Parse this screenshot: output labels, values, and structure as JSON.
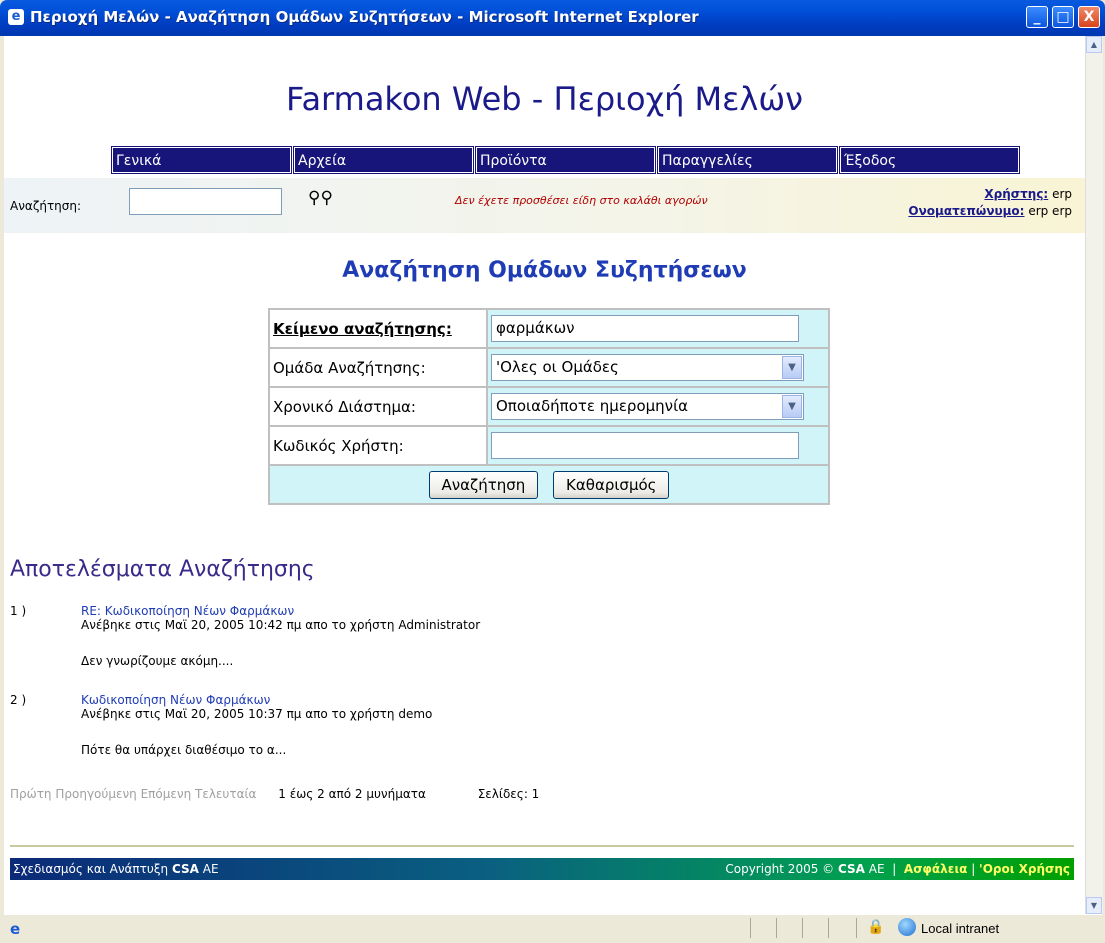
{
  "window": {
    "title": "Περιοχή Μελών - Αναζήτηση Ομάδων Συζητήσεων - Microsoft Internet Explorer",
    "minimize": "_",
    "maximize": "□",
    "close": "X"
  },
  "site": {
    "title": "Farmakon Web - Περιοχή Μελών"
  },
  "nav": [
    "Γενικά",
    "Αρχεία",
    "Προϊόντα",
    "Παραγγελίες",
    "Έξοδος"
  ],
  "infobar": {
    "search_label": "Αναζήτηση:",
    "search_value": "",
    "cart_message": "Δεν έχετε προσθέσει είδη στο καλάθι αγορών",
    "user_label": "Χρήστης:",
    "user_value": "erp",
    "fullname_label": "Ονοματεπώνυμο:",
    "fullname_value": "erp erp"
  },
  "form": {
    "title": "Αναζήτηση Ομάδων Συζητήσεων",
    "text_label": "Κείμενο αναζήτησης:",
    "text_value": "φαρμάκων",
    "group_label": "Ομάδα Αναζήτησης:",
    "group_value": "'Ολες οι Ομάδες",
    "period_label": "Χρονικό Διάστημα:",
    "period_value": "Οποιαδήποτε ημερομηνία",
    "user_label": "Κωδικός Χρήστη:",
    "user_value": "",
    "search_button": "Αναζήτηση",
    "clear_button": "Καθαρισμός"
  },
  "results": {
    "title": "Αποτελέσματα Αναζήτησης",
    "items": [
      {
        "num": "1 )",
        "subject": "RE: Κωδικοποίηση Νέων Φαρμάκων",
        "meta": "Ανέβηκε στις Μαϊ 20, 2005 10:42 πμ απο το χρήστη Administrator",
        "snippet": "Δεν γνωρίζουμε ακόμη...."
      },
      {
        "num": "2 )",
        "subject": "Κωδικοποίηση Νέων Φαρμάκων",
        "meta": "Ανέβηκε στις Μαϊ 20, 2005 10:37 πμ απο το χρήστη demo",
        "snippet": "Πότε θα υπάρχει διαθέσιμο το α..."
      }
    ],
    "pager": {
      "first": "Πρώτη",
      "prev": "Προηγούμενη",
      "next": "Επόμενη",
      "last": "Τελευταία",
      "count": "1 έως 2 από 2 μυνήματα",
      "pages": "Σελίδες: 1"
    }
  },
  "footer": {
    "design_prefix": "Σχεδιασμός και Ανάπτυξη",
    "design_company": "CSA",
    "design_suffix": "AE",
    "copyright_prefix": "Copyright 2005 ©",
    "copyright_company": "CSA",
    "copyright_suffix": "AE",
    "security": "Ασφάλεια",
    "terms": "'Οροι Χρήσης"
  },
  "status": {
    "zone": "Local intranet"
  }
}
